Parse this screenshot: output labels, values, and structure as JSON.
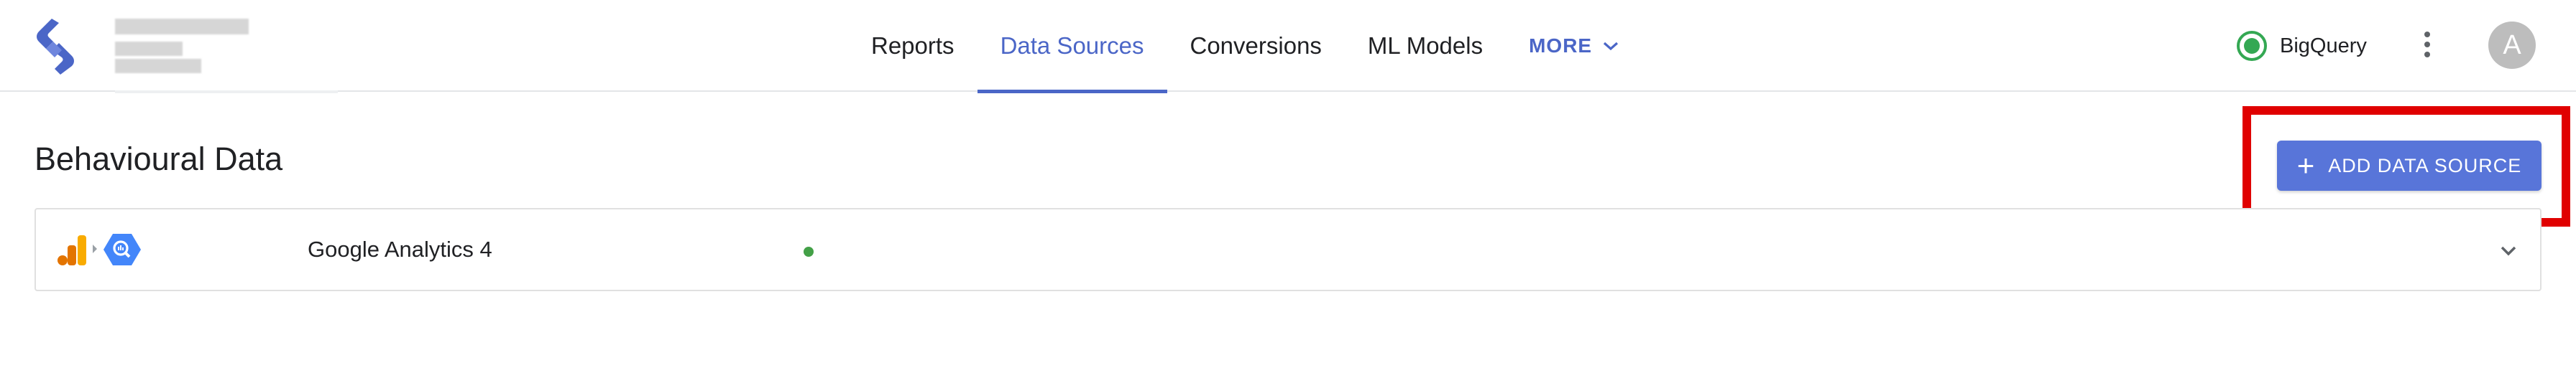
{
  "header": {
    "nav": [
      {
        "label": "Reports",
        "active": false
      },
      {
        "label": "Data Sources",
        "active": true
      },
      {
        "label": "Conversions",
        "active": false
      },
      {
        "label": "ML Models",
        "active": false
      }
    ],
    "more_label": "MORE",
    "warehouse_label": "BigQuery",
    "avatar_initial": "A"
  },
  "main": {
    "title": "Behavioural Data",
    "add_button_label": "ADD DATA SOURCE",
    "sources": [
      {
        "name": "Google Analytics 4",
        "status": "connected"
      }
    ]
  },
  "colors": {
    "accent": "#4b66c7",
    "button": "#5875d9",
    "status_green": "#34a853",
    "highlight": "#e00000"
  },
  "icons": {
    "logo": "lightning-logo-icon",
    "more": "chevron-down-icon",
    "warehouse_status": "status-dot-icon",
    "menu": "more-vertical-icon",
    "add": "plus-icon",
    "ga": "google-analytics-icon",
    "connector": "chevron-right-icon",
    "bigquery": "bigquery-icon",
    "expand": "chevron-down-icon"
  }
}
